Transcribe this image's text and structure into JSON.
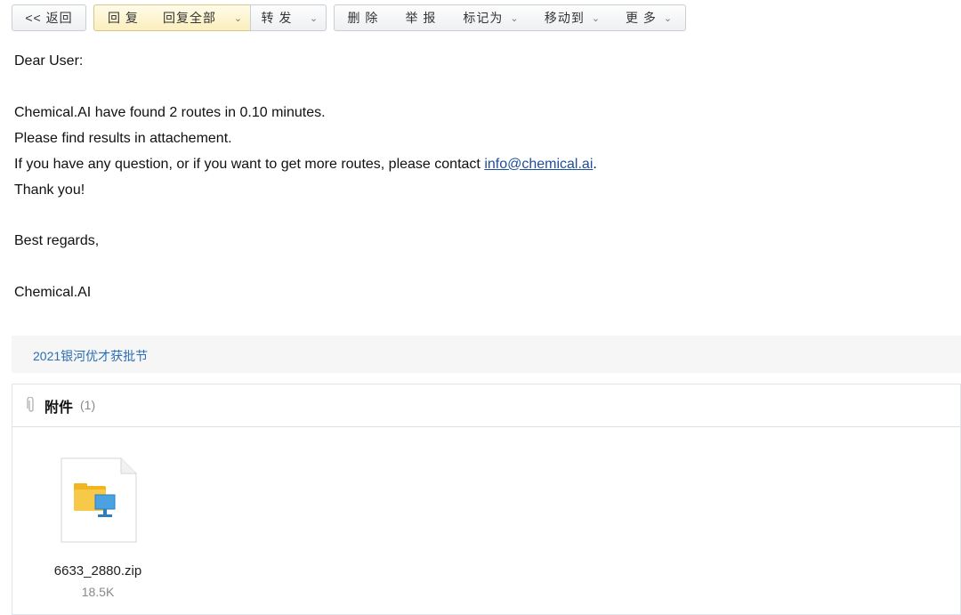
{
  "toolbar": {
    "back": "<< 返回",
    "reply": "回 复",
    "reply_all": "回复全部",
    "forward": "转 发",
    "delete": "删 除",
    "report": "举 报",
    "mark_as": "标记为",
    "move_to": "移动到",
    "more": "更 多",
    "caret": "⌄"
  },
  "email": {
    "greeting": "Dear User:",
    "line1": "Chemical.AI have found 2 routes in 0.10 minutes.",
    "line2": "Please find results in attachement.",
    "line3_prefix": "If you have any question, or if you want to get more routes, please contact ",
    "contact_link": "info@chemical.ai",
    "line3_suffix": ".",
    "line4": "Thank you!",
    "closing": "Best regards,",
    "signature": "Chemical.AI"
  },
  "promo": {
    "text": "2021银河优才获批节"
  },
  "attachments": {
    "title": "附件",
    "count": "(1)",
    "files": [
      {
        "name": "6633_2880.zip",
        "size": "18.5K",
        "icon": "zip-file-icon"
      }
    ]
  },
  "colors": {
    "link": "#1f4f9a",
    "promo_link": "#2a6db5",
    "reply_bg": "#fbefbd"
  }
}
